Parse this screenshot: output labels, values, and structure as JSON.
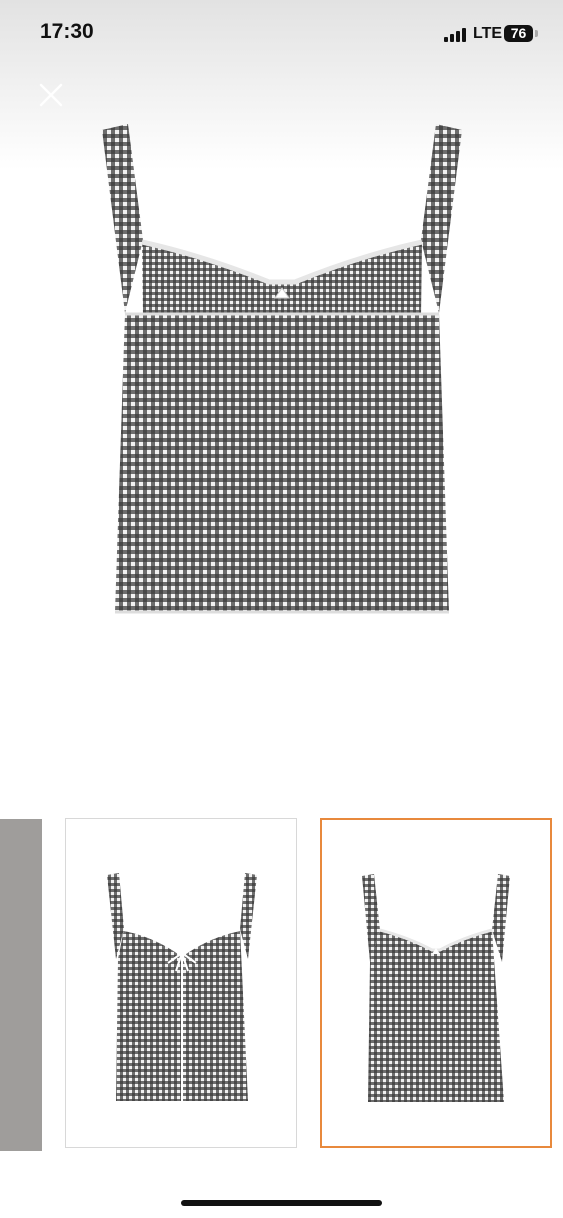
{
  "status_bar": {
    "time": "17:30",
    "network": "LTE",
    "battery": "76"
  },
  "icons": {
    "close": "close-icon",
    "signal": "signal-bars-icon",
    "battery": "battery-icon"
  },
  "gallery": {
    "selected_index": 2,
    "accent_color": "#e8893c"
  }
}
